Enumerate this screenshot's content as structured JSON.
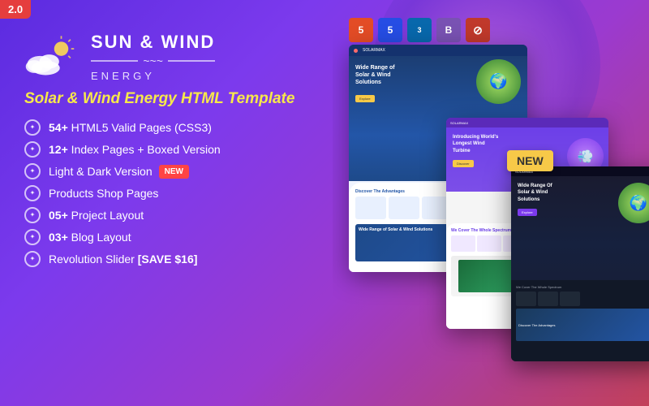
{
  "version": "2.0",
  "logo": {
    "title": "SUN & WIND",
    "subtitle": "ENERGY",
    "tilde": "~~~"
  },
  "template_title": "Solar & Wind Energy HTML Template",
  "features": [
    {
      "id": "f1",
      "text": " HTML5 Valid Pages (CSS3)",
      "highlight": "54+",
      "badge": null
    },
    {
      "id": "f2",
      "text": " Index Pages + Boxed Version",
      "highlight": "12+",
      "badge": null
    },
    {
      "id": "f3",
      "text": "Light & Dark Version",
      "highlight": "",
      "badge": "NEW"
    },
    {
      "id": "f4",
      "text": "Products Shop Pages",
      "highlight": "",
      "badge": null
    },
    {
      "id": "f5",
      "text": " Project Layout",
      "highlight": "05+",
      "badge": null
    },
    {
      "id": "f6",
      "text": " Blog Layout",
      "highlight": "03+",
      "badge": null
    },
    {
      "id": "f7",
      "text": "Revolution Slider ",
      "highlight": "[SAVE $16]",
      "badge": null
    }
  ],
  "tech_icons": [
    {
      "id": "html5",
      "label": "5",
      "title": "HTML5"
    },
    {
      "id": "css3",
      "label": "5",
      "title": "CSS3"
    },
    {
      "id": "jquery",
      "label": "3",
      "title": "jQuery"
    },
    {
      "id": "bootstrap",
      "label": "B",
      "title": "Bootstrap"
    },
    {
      "id": "revolution",
      "label": "⟳",
      "title": "Revolution Slider"
    }
  ],
  "screenshots": {
    "main_hero": "Wide Range of Solar & Wind Solutions",
    "mid_hero": "Introducing World's Longest Wind Turbine",
    "dark_hero": "Wide Range Of Solar & Wind Solutions"
  },
  "colors": {
    "accent_yellow": "#f7c948",
    "accent_red": "#e53e3e",
    "accent_purple": "#7c3aed",
    "bg_gradient_start": "#5b2be0",
    "bg_gradient_end": "#c2415a"
  }
}
